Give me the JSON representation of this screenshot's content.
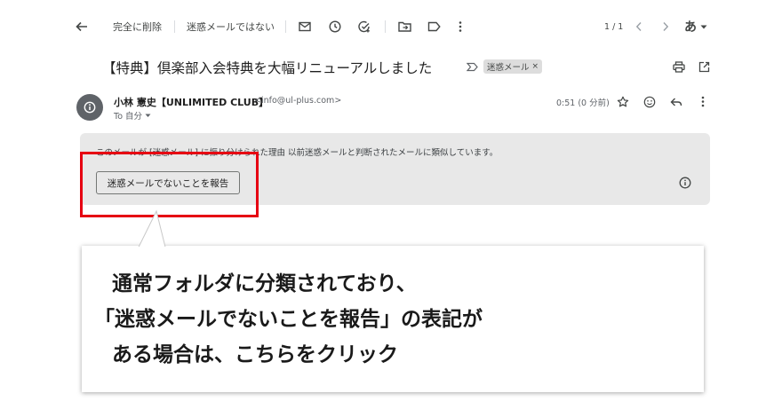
{
  "toolbar": {
    "delete_forever": "完全に削除",
    "not_spam": "迷惑メールではない",
    "pagination": "1 / 1",
    "input_mode": "あ"
  },
  "email": {
    "subject": "【特典】倶楽部入会特典を大幅リニューアルしました",
    "label": "迷惑メール",
    "label_remove": "×",
    "sender_name": "小林 憲史【UNLIMITED CLUB】",
    "sender_email": "<info@ul-plus.com>",
    "recipient": "To 自分",
    "time": "0:51 (0 分前)"
  },
  "spam_banner": {
    "reason": "このメールが [迷惑メール] に振り分けられた理由 以前迷惑メールと判断されたメールに類似しています。",
    "report_button": "迷惑メールでないことを報告"
  },
  "callout": {
    "line1": "通常フォルダに分類されており、",
    "line2": "「迷惑メールでないことを報告」の表記が",
    "line3": "ある場合は、こちらをクリック"
  },
  "colors": {
    "highlight": "#e60012",
    "banner_bg": "#e8e8e8",
    "avatar_bg": "#5f6368"
  }
}
